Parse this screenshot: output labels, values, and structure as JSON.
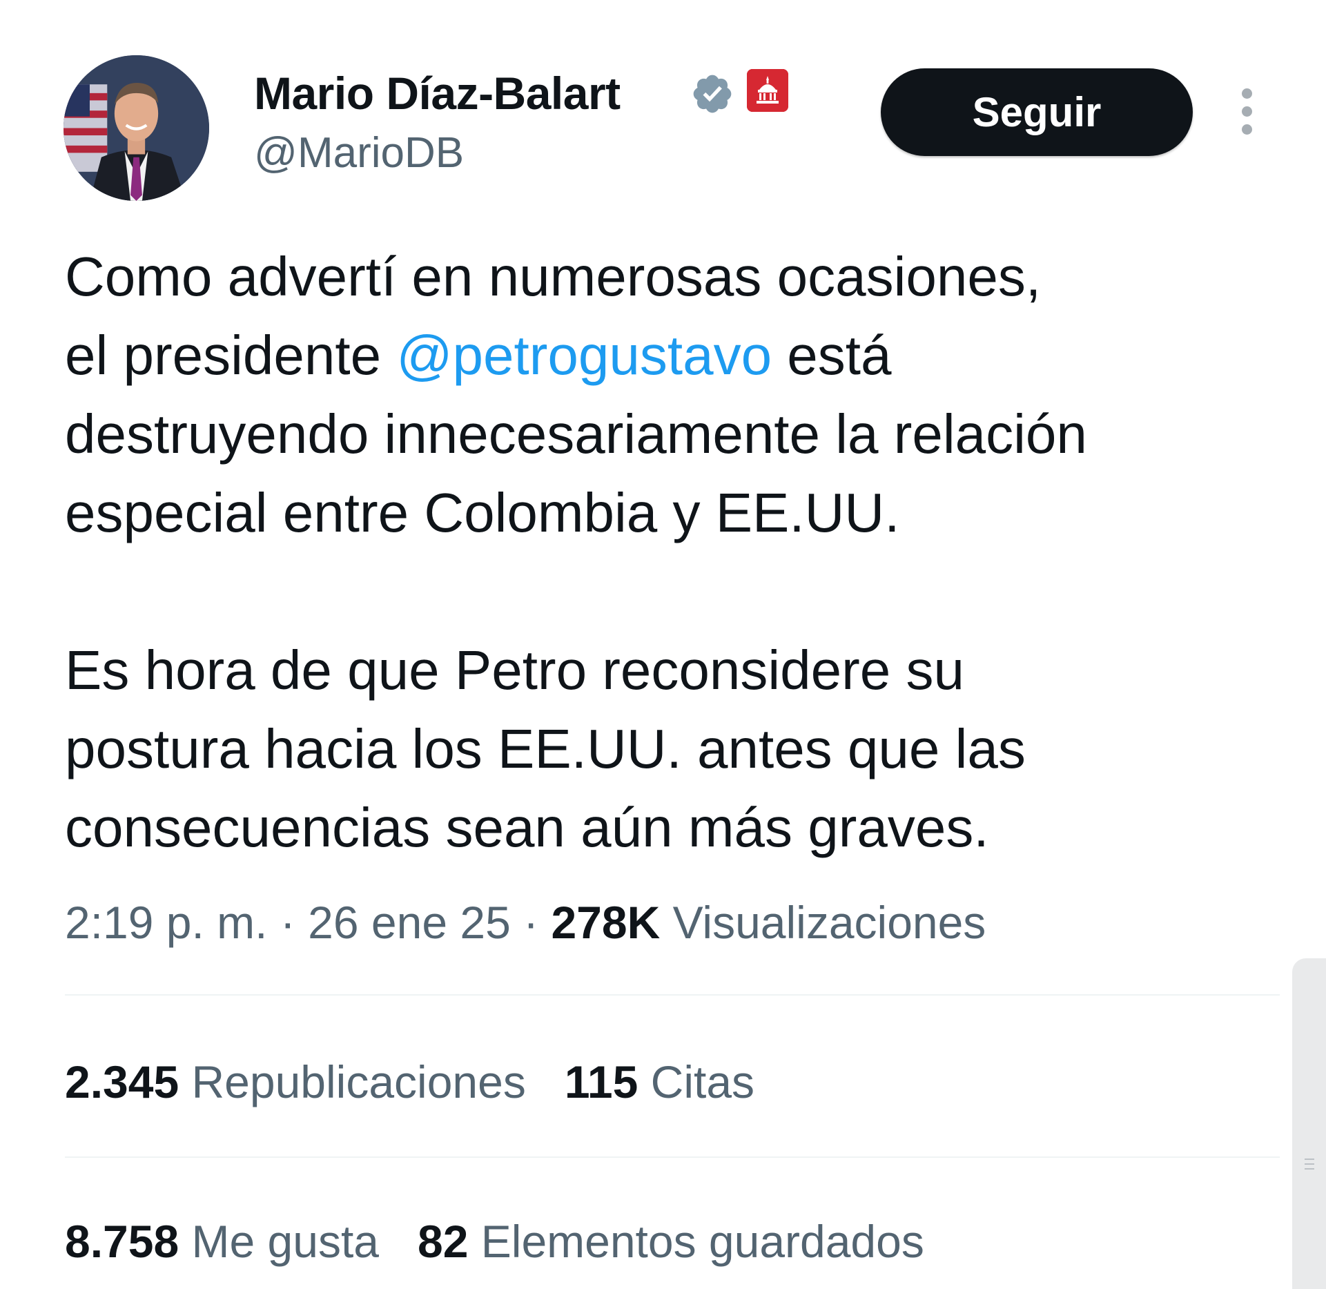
{
  "author": {
    "display_name": "Mario Díaz-Balart",
    "handle": "@MarioDB",
    "avatar_icon": "profile-photo",
    "verified_icon": "verified-badge-icon",
    "affiliation_icon": "government-badge-icon"
  },
  "actions": {
    "follow_label": "Seguir",
    "more_icon": "more-vertical-icon"
  },
  "tweet": {
    "line1": "Como advertí en numerosas ocasiones,",
    "line2_pre": "el presidente ",
    "line2_mention": "@petrogustavo",
    "line2_post": " está",
    "line3": "destruyendo innecesariamente la relación",
    "line4": "especial entre Colombia y EE.UU.",
    "line5": "Es hora de que Petro reconsidere su",
    "line6": "postura hacia los EE.UU. antes que las",
    "line7": "consecuencias sean aún más graves."
  },
  "meta": {
    "time": "2:19 p. m.",
    "separator": "·",
    "date": "26 ene 25",
    "views_count": "278K",
    "views_label": "Visualizaciones"
  },
  "stats": {
    "reposts_count": "2.345",
    "reposts_label": "Republicaciones",
    "quotes_count": "115",
    "quotes_label": "Citas",
    "likes_count": "8.758",
    "likes_label": "Me gusta",
    "bookmarks_count": "82",
    "bookmarks_label": "Elementos guardados"
  },
  "colors": {
    "text": "#0f1419",
    "secondary_text": "#536471",
    "mention": "#1d9bf0",
    "follow_button_bg": "#0f1419",
    "verified": "#829aab",
    "gov_badge": "#d62832"
  }
}
